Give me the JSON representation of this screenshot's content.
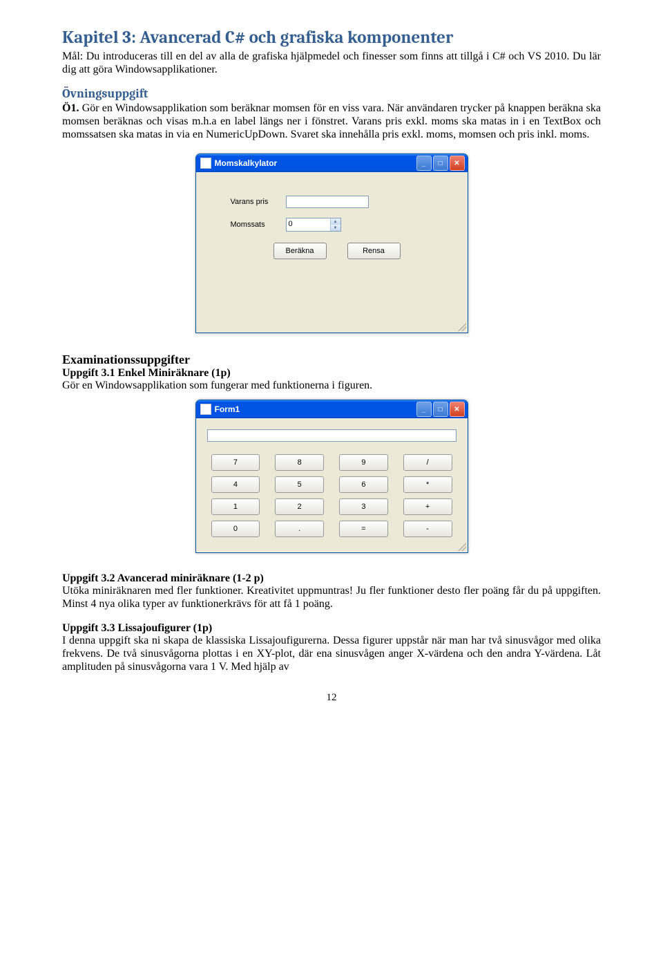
{
  "chapter_title": "Kapitel 3: Avancerad C# och grafiska komponenter",
  "intro": "Mål: Du introduceras till en del av alla de grafiska hjälpmedel och finesser som finns att tillgå i C# och VS 2010. Du lär dig att göra Windowsapplikationer.",
  "ovning_heading": "Övningsuppgift",
  "o1_label": "Ö1.",
  "o1_text": "Gör en Windowsapplikation som beräknar momsen för en viss vara. När användaren trycker på knappen beräkna ska momsen beräknas och visas m.h.a en label längs ner i fönstret. Varans pris exkl. moms ska matas in i en TextBox och momssatsen ska matas in via en NumericUpDown. Svaret ska innehålla pris exkl. moms, momsen och pris inkl. moms.",
  "moms": {
    "title": "Momskalkylator",
    "label_price": "Varans pris",
    "label_rate": "Momssats",
    "rate_value": "0",
    "btn_calc": "Beräkna",
    "btn_clear": "Rensa"
  },
  "exams_heading": "Examinationssuppgifter",
  "u31_title": "Uppgift 3.1 Enkel Miniräknare (1p)",
  "u31_text": "Gör en Windowsapplikation som fungerar med funktionerna i figuren.",
  "calc": {
    "title": "Form1",
    "keys": [
      "7",
      "8",
      "9",
      "/",
      "4",
      "5",
      "6",
      "*",
      "1",
      "2",
      "3",
      "+",
      "0",
      ".",
      "=",
      "-"
    ]
  },
  "u32_title": "Uppgift 3.2 Avancerad miniräknare (1-2 p)",
  "u32_text": "Utöka miniräknaren med fler funktioner. Kreativitet uppmuntras! Ju fler funktioner desto fler poäng får du på uppgiften. Minst 4 nya olika typer av funktionerkrävs för att få 1 poäng.",
  "u33_title": "Uppgift 3.3 Lissajoufigurer (1p)",
  "u33_text": "I denna uppgift ska ni skapa de klassiska Lissajoufigurerna. Dessa figurer uppstår när man har två sinusvågor med olika frekvens. De två sinusvågorna plottas i en XY-plot, där ena sinusvågen anger X-värdena och den andra Y-värdena. Låt amplituden på sinusvågorna vara 1 V. Med hjälp av",
  "page_number": "12"
}
